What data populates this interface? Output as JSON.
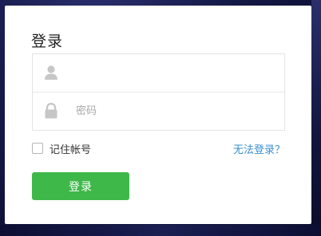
{
  "login": {
    "title": "登录",
    "account": {
      "icon": "user-icon",
      "value": "",
      "placeholder": ""
    },
    "password": {
      "icon": "lock-icon",
      "value": "",
      "placeholder": "密码"
    },
    "remember_label": "记住帐号",
    "remember_checked": false,
    "forgot_label": "无法登录？",
    "submit_label": "登录"
  },
  "colors": {
    "accent_green": "#3fb84a",
    "link_blue": "#3a8fd0",
    "icon_gray": "#c7c7c7",
    "background_navy": "#141845"
  }
}
